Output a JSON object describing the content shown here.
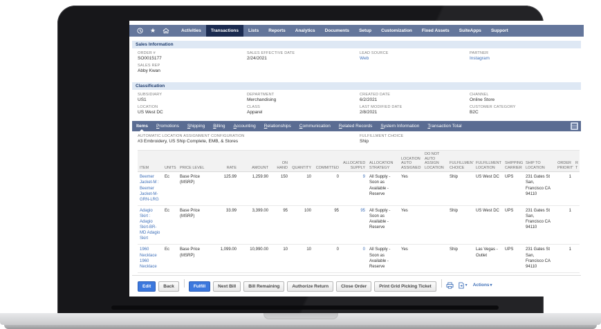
{
  "colors": {
    "navbar_bg": "#64769B",
    "navbar_active_bg": "#1B2B50",
    "subtab_bg": "#5A6C92",
    "section_header_bg": "#DEE8F4",
    "section_header_text": "#1F3C6D",
    "link": "#3E6FB8",
    "primary_button": "#3C78DD"
  },
  "navbar": {
    "icons": [
      {
        "name": "recent-records-clock-icon"
      },
      {
        "name": "shortcuts-star-icon"
      },
      {
        "name": "home-icon"
      }
    ],
    "items": [
      {
        "label": "Activities"
      },
      {
        "label": "Transactions",
        "active": true
      },
      {
        "label": "Lists"
      },
      {
        "label": "Reports"
      },
      {
        "label": "Analytics"
      },
      {
        "label": "Documents"
      },
      {
        "label": "Setup"
      },
      {
        "label": "Customization"
      },
      {
        "label": "Fixed Assets"
      },
      {
        "label": "SuiteApps"
      },
      {
        "label": "Support"
      }
    ]
  },
  "sections": {
    "sales_information": {
      "title": "Sales Information",
      "fields": [
        {
          "label": "ORDER #",
          "value": "SO0015177"
        },
        {
          "label": "SALES EFFECTIVE DATE",
          "value": "2/24/2021"
        },
        {
          "label": "LEAD SOURCE",
          "value": "Web",
          "link": true
        },
        {
          "label": "PARTNER",
          "value": "Instagram",
          "link": true
        },
        {
          "label": "SALES REP",
          "value": "Abby Kwan"
        }
      ]
    },
    "classification": {
      "title": "Classification",
      "fields": [
        {
          "label": "SUBSIDIARY",
          "value": "US1"
        },
        {
          "label": "DEPARTMENT",
          "value": "Merchandising"
        },
        {
          "label": "CREATED DATE",
          "value": "6/2/2021"
        },
        {
          "label": "CHANNEL",
          "value": "Online Store"
        },
        {
          "label": "LOCATION",
          "value": "US West DC"
        },
        {
          "label": "CLASS",
          "value": "Apparel"
        },
        {
          "label": "LAST MODIFIED DATE",
          "value": "2/8/2021"
        },
        {
          "label": "CUSTOMER CATEGORY",
          "value": "B2C"
        }
      ]
    }
  },
  "subtabs": {
    "items": [
      {
        "label": "Items",
        "active": true
      },
      {
        "label": "Promotions"
      },
      {
        "label": "Shipping"
      },
      {
        "label": "Billing"
      },
      {
        "label": "Accounting"
      },
      {
        "label": "Relationships"
      },
      {
        "label": "Communication"
      },
      {
        "label": "Related Records"
      },
      {
        "label": "System Information"
      },
      {
        "label": "Transaction Total"
      }
    ],
    "panel_icon": "list-toggle-icon"
  },
  "config": {
    "fields": [
      {
        "label": "AUTOMATIC LOCATION ASSIGNMENT CONFIGURATION",
        "value": "#3 Embroidery, US Ship Complete, EMB, & Stores"
      },
      {
        "label": "FULFILLMENT CHOICE",
        "value": "Ship"
      }
    ]
  },
  "items_table": {
    "columns": [
      {
        "key": "item",
        "label": "ITEM",
        "align": "left",
        "type": "link"
      },
      {
        "key": "units",
        "label": "UNITS",
        "align": "left",
        "type": "text"
      },
      {
        "key": "price_level",
        "label": "PRICE LEVEL",
        "align": "left",
        "type": "text"
      },
      {
        "key": "rate",
        "label": "RATE",
        "align": "right",
        "type": "text"
      },
      {
        "key": "amount",
        "label": "AMOUNT",
        "align": "right",
        "type": "text"
      },
      {
        "key": "on_hand",
        "label": "ON HAND",
        "align": "right",
        "type": "text"
      },
      {
        "key": "quantity",
        "label": "QUANTITY",
        "align": "right",
        "type": "text"
      },
      {
        "key": "committed",
        "label": "COMMITTED",
        "align": "right",
        "type": "text"
      },
      {
        "key": "allocated_supply",
        "label": "ALLOCATED SUPPLY",
        "align": "right",
        "type": "link"
      },
      {
        "key": "allocation_strategy",
        "label": "ALLOCATION STRATEGY",
        "align": "left",
        "type": "text"
      },
      {
        "key": "location_auto_assigned",
        "label": "LOCATION AUTO ASSIGNED",
        "align": "left",
        "type": "text"
      },
      {
        "key": "do_not_auto_assign_location",
        "label": "DO NOT AUTO ASSIGN LOCATION",
        "align": "left",
        "type": "text"
      },
      {
        "key": "fulfillment_choice",
        "label": "FULFILLMENT CHOICE",
        "align": "left",
        "type": "text"
      },
      {
        "key": "fulfillment_location",
        "label": "FULFILLMENT LOCATION",
        "align": "left",
        "type": "text"
      },
      {
        "key": "shipping_carrier",
        "label": "SHIPPING CARRIER",
        "align": "left",
        "type": "text"
      },
      {
        "key": "ship_to_location",
        "label": "SHIP TO LOCATION",
        "align": "left",
        "type": "text"
      },
      {
        "key": "order_priority",
        "label": "ORDER PRIORITY",
        "align": "right",
        "type": "text"
      },
      {
        "key": "clipped",
        "label": "R T",
        "align": "left",
        "type": "text"
      }
    ],
    "rows": [
      {
        "item": "Beemer Jacket-M : Beemer Jacket-M-GRN-LRG",
        "units": "Ec",
        "price_level": "Base Price (MSRP)",
        "rate": "125.99",
        "amount": "1,259.90",
        "on_hand": "150",
        "quantity": "10",
        "committed": "0",
        "allocated_supply": "9",
        "allocation_strategy": "All Supply - Soon as Available - Reserve",
        "location_auto_assigned": "Yes",
        "do_not_auto_assign_location": "",
        "fulfillment_choice": "Ship",
        "fulfillment_location": "US West DC",
        "shipping_carrier": "UPS",
        "ship_to_location": "231 Gates St San, Francisco CA 94110",
        "order_priority": "1",
        "clipped": ""
      },
      {
        "item": "Adagio Skirt : Adagio Skirt-BR-MD Adagio Skirt",
        "units": "Ec",
        "price_level": "Base Price (MSRP)",
        "rate": "33.99",
        "amount": "3,399.00",
        "on_hand": "95",
        "quantity": "100",
        "committed": "95",
        "allocated_supply": "95",
        "allocation_strategy": "All Supply - Soon as Available - Reserve",
        "location_auto_assigned": "Yes",
        "do_not_auto_assign_location": "",
        "fulfillment_choice": "Ship",
        "fulfillment_location": "US West DC",
        "shipping_carrier": "UPS",
        "ship_to_location": "231 Gates St San, Francisco CA 94110",
        "order_priority": "1",
        "clipped": ""
      },
      {
        "item": "1960 Necklace 1960 Necklace",
        "units": "Ec",
        "price_level": "Base Price (MSRP)",
        "rate": "1,099.00",
        "amount": "10,990.00",
        "on_hand": "10",
        "quantity": "10",
        "committed": "0",
        "allocated_supply": "0",
        "allocation_strategy": "All Supply - Soon as Available - Reserve",
        "location_auto_assigned": "Yes",
        "do_not_auto_assign_location": "",
        "fulfillment_choice": "Ship",
        "fulfillment_location": "Las Vegas - Outlet",
        "shipping_carrier": "UPS",
        "ship_to_location": "231 Gates St San, Francisco CA 94110",
        "order_priority": "1",
        "clipped": ""
      }
    ]
  },
  "footer": {
    "buttons": [
      {
        "label": "Edit",
        "style": "primary"
      },
      {
        "label": "Back",
        "style": "gray"
      },
      {
        "type": "separator"
      },
      {
        "label": "Fulfill",
        "style": "primary"
      },
      {
        "label": "Next Bill",
        "style": "gray"
      },
      {
        "label": "Bill Remaining",
        "style": "gray"
      },
      {
        "label": "Authorize Return",
        "style": "gray"
      },
      {
        "label": "Close Order",
        "style": "gray"
      },
      {
        "label": "Print Grid Picking Ticket",
        "style": "gray"
      },
      {
        "type": "separator"
      }
    ],
    "icons": [
      {
        "name": "printer-icon"
      },
      {
        "name": "export-icon"
      }
    ],
    "actions_label": "Actions"
  }
}
